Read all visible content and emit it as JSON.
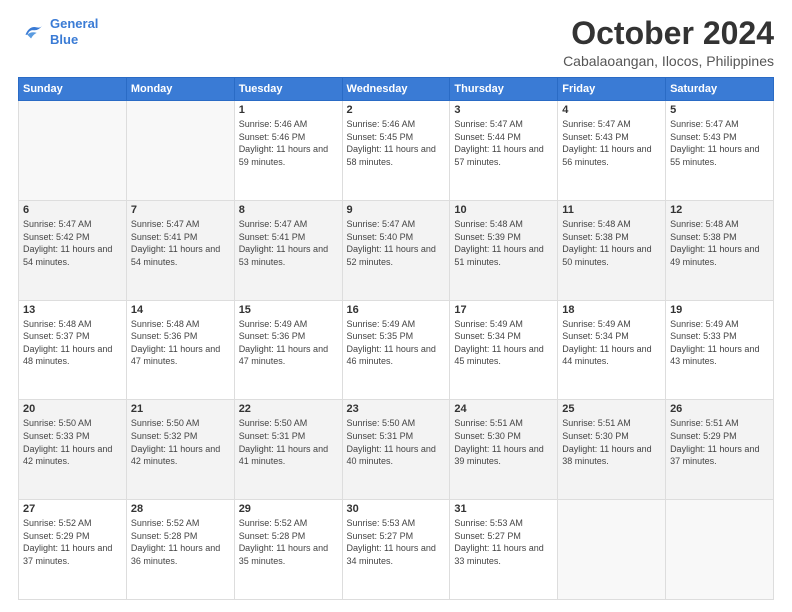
{
  "logo": {
    "line1": "General",
    "line2": "Blue"
  },
  "title": "October 2024",
  "location": "Cabalaoangan, Ilocos, Philippines",
  "days_header": [
    "Sunday",
    "Monday",
    "Tuesday",
    "Wednesday",
    "Thursday",
    "Friday",
    "Saturday"
  ],
  "weeks": [
    [
      {
        "day": "",
        "text": ""
      },
      {
        "day": "",
        "text": ""
      },
      {
        "day": "1",
        "text": "Sunrise: 5:46 AM\nSunset: 5:46 PM\nDaylight: 11 hours and 59 minutes."
      },
      {
        "day": "2",
        "text": "Sunrise: 5:46 AM\nSunset: 5:45 PM\nDaylight: 11 hours and 58 minutes."
      },
      {
        "day": "3",
        "text": "Sunrise: 5:47 AM\nSunset: 5:44 PM\nDaylight: 11 hours and 57 minutes."
      },
      {
        "day": "4",
        "text": "Sunrise: 5:47 AM\nSunset: 5:43 PM\nDaylight: 11 hours and 56 minutes."
      },
      {
        "day": "5",
        "text": "Sunrise: 5:47 AM\nSunset: 5:43 PM\nDaylight: 11 hours and 55 minutes."
      }
    ],
    [
      {
        "day": "6",
        "text": "Sunrise: 5:47 AM\nSunset: 5:42 PM\nDaylight: 11 hours and 54 minutes."
      },
      {
        "day": "7",
        "text": "Sunrise: 5:47 AM\nSunset: 5:41 PM\nDaylight: 11 hours and 54 minutes."
      },
      {
        "day": "8",
        "text": "Sunrise: 5:47 AM\nSunset: 5:41 PM\nDaylight: 11 hours and 53 minutes."
      },
      {
        "day": "9",
        "text": "Sunrise: 5:47 AM\nSunset: 5:40 PM\nDaylight: 11 hours and 52 minutes."
      },
      {
        "day": "10",
        "text": "Sunrise: 5:48 AM\nSunset: 5:39 PM\nDaylight: 11 hours and 51 minutes."
      },
      {
        "day": "11",
        "text": "Sunrise: 5:48 AM\nSunset: 5:38 PM\nDaylight: 11 hours and 50 minutes."
      },
      {
        "day": "12",
        "text": "Sunrise: 5:48 AM\nSunset: 5:38 PM\nDaylight: 11 hours and 49 minutes."
      }
    ],
    [
      {
        "day": "13",
        "text": "Sunrise: 5:48 AM\nSunset: 5:37 PM\nDaylight: 11 hours and 48 minutes."
      },
      {
        "day": "14",
        "text": "Sunrise: 5:48 AM\nSunset: 5:36 PM\nDaylight: 11 hours and 47 minutes."
      },
      {
        "day": "15",
        "text": "Sunrise: 5:49 AM\nSunset: 5:36 PM\nDaylight: 11 hours and 47 minutes."
      },
      {
        "day": "16",
        "text": "Sunrise: 5:49 AM\nSunset: 5:35 PM\nDaylight: 11 hours and 46 minutes."
      },
      {
        "day": "17",
        "text": "Sunrise: 5:49 AM\nSunset: 5:34 PM\nDaylight: 11 hours and 45 minutes."
      },
      {
        "day": "18",
        "text": "Sunrise: 5:49 AM\nSunset: 5:34 PM\nDaylight: 11 hours and 44 minutes."
      },
      {
        "day": "19",
        "text": "Sunrise: 5:49 AM\nSunset: 5:33 PM\nDaylight: 11 hours and 43 minutes."
      }
    ],
    [
      {
        "day": "20",
        "text": "Sunrise: 5:50 AM\nSunset: 5:33 PM\nDaylight: 11 hours and 42 minutes."
      },
      {
        "day": "21",
        "text": "Sunrise: 5:50 AM\nSunset: 5:32 PM\nDaylight: 11 hours and 42 minutes."
      },
      {
        "day": "22",
        "text": "Sunrise: 5:50 AM\nSunset: 5:31 PM\nDaylight: 11 hours and 41 minutes."
      },
      {
        "day": "23",
        "text": "Sunrise: 5:50 AM\nSunset: 5:31 PM\nDaylight: 11 hours and 40 minutes."
      },
      {
        "day": "24",
        "text": "Sunrise: 5:51 AM\nSunset: 5:30 PM\nDaylight: 11 hours and 39 minutes."
      },
      {
        "day": "25",
        "text": "Sunrise: 5:51 AM\nSunset: 5:30 PM\nDaylight: 11 hours and 38 minutes."
      },
      {
        "day": "26",
        "text": "Sunrise: 5:51 AM\nSunset: 5:29 PM\nDaylight: 11 hours and 37 minutes."
      }
    ],
    [
      {
        "day": "27",
        "text": "Sunrise: 5:52 AM\nSunset: 5:29 PM\nDaylight: 11 hours and 37 minutes."
      },
      {
        "day": "28",
        "text": "Sunrise: 5:52 AM\nSunset: 5:28 PM\nDaylight: 11 hours and 36 minutes."
      },
      {
        "day": "29",
        "text": "Sunrise: 5:52 AM\nSunset: 5:28 PM\nDaylight: 11 hours and 35 minutes."
      },
      {
        "day": "30",
        "text": "Sunrise: 5:53 AM\nSunset: 5:27 PM\nDaylight: 11 hours and 34 minutes."
      },
      {
        "day": "31",
        "text": "Sunrise: 5:53 AM\nSunset: 5:27 PM\nDaylight: 11 hours and 33 minutes."
      },
      {
        "day": "",
        "text": ""
      },
      {
        "day": "",
        "text": ""
      }
    ]
  ]
}
